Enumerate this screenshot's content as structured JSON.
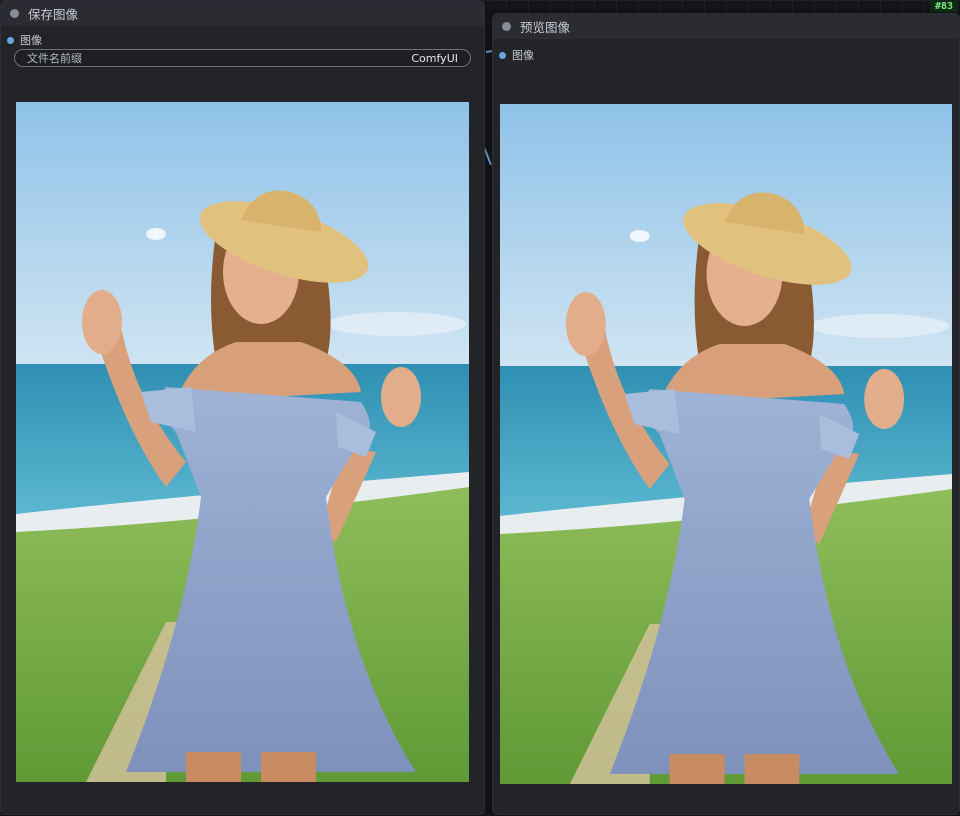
{
  "save_node": {
    "title": "保存图像",
    "input_label": "图像",
    "widget_label": "文件名前缀",
    "widget_value": "ComfyUI"
  },
  "preview_node": {
    "title": "预览图像",
    "input_label": "图像",
    "badge": "#83"
  },
  "colors": {
    "node_bg": "#222428",
    "title_bg": "#2a2c31",
    "slot_image": "#6aa6e0",
    "badge_text": "#7df07e"
  }
}
